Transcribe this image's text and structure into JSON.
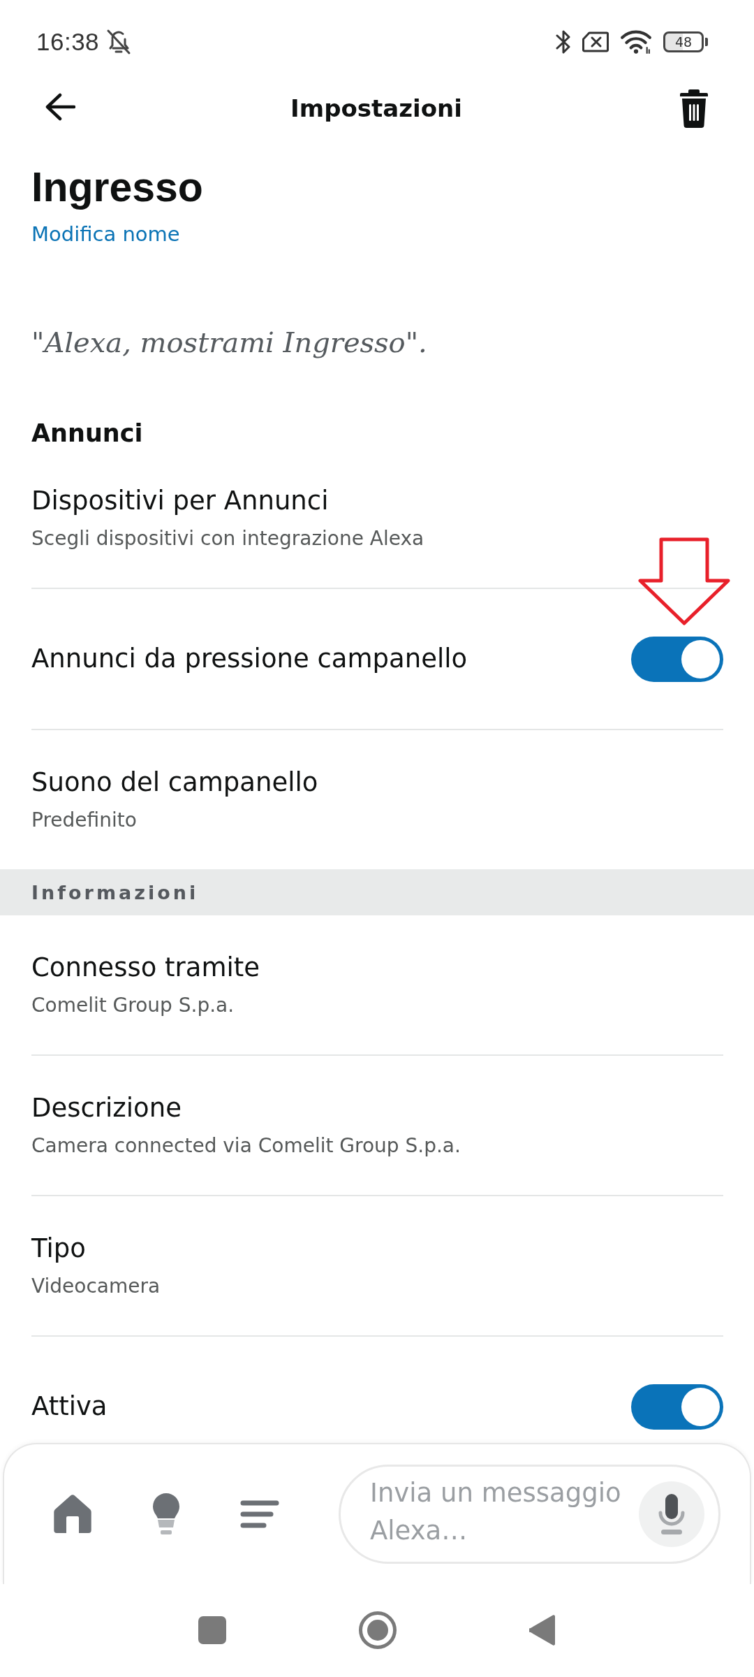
{
  "status_bar": {
    "time": "16:38",
    "battery": "48"
  },
  "header": {
    "title": "Impostazioni"
  },
  "device": {
    "name": "Ingresso",
    "rename_link": "Modifica nome",
    "voice_hint": "\"Alexa, mostrami Ingresso\"."
  },
  "sections": [
    {
      "kind": "plain",
      "title": "Annunci",
      "rows": [
        {
          "kind": "text",
          "title": "Dispositivi per Annunci",
          "subtitle": "Scegli dispositivi con integrazione Alexa",
          "annotated": false
        },
        {
          "kind": "toggle",
          "title": "Annunci da pressione campanello",
          "on": true,
          "annotated": true
        },
        {
          "kind": "text",
          "title": "Suono del campanello",
          "subtitle": "Predefinito",
          "annotated": false
        }
      ]
    },
    {
      "kind": "band",
      "title": "Informazioni",
      "rows": [
        {
          "kind": "text",
          "title": "Connesso tramite",
          "subtitle": "Comelit Group S.p.a.",
          "annotated": false
        },
        {
          "kind": "text",
          "title": "Descrizione",
          "subtitle": "Camera connected via Comelit Group S.p.a.",
          "annotated": false
        },
        {
          "kind": "text",
          "title": "Tipo",
          "subtitle": "Videocamera",
          "annotated": false
        },
        {
          "kind": "toggle",
          "title": "Attiva",
          "on": true,
          "annotated": false
        }
      ]
    }
  ],
  "bottom_bar": {
    "message_field": {
      "placeholder": "Invia un messaggio Alexa…"
    }
  }
}
